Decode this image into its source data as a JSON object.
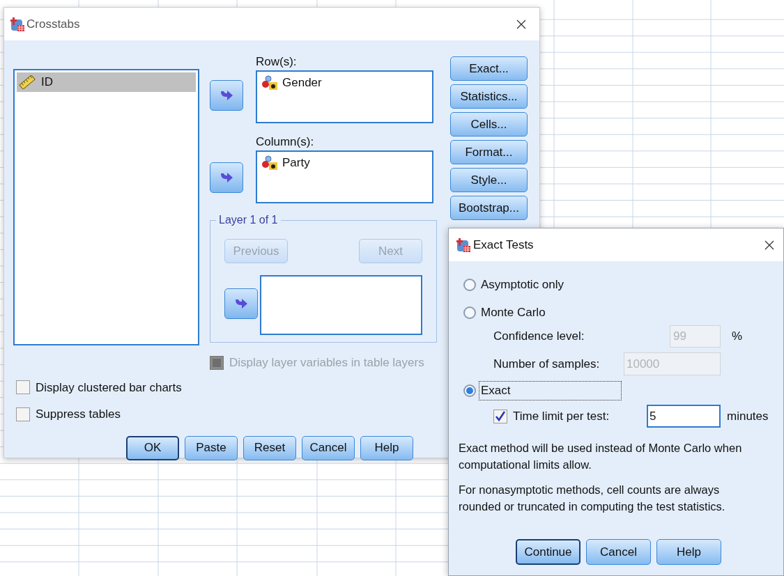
{
  "crosstabs": {
    "title": "Crosstabs",
    "variables": [
      {
        "label": "ID",
        "kind": "scale",
        "selected": true
      }
    ],
    "rows_label": "Row(s):",
    "rows_items": [
      {
        "label": "Gender",
        "kind": "nominal"
      }
    ],
    "columns_label": "Column(s):",
    "columns_items": [
      {
        "label": "Party",
        "kind": "nominal"
      }
    ],
    "side_buttons": [
      "Exact...",
      "Statistics...",
      "Cells...",
      "Format...",
      "Style...",
      "Bootstrap..."
    ],
    "layer": {
      "title": "Layer 1 of 1",
      "previous": {
        "label": "Previous",
        "disabled": true
      },
      "next": {
        "label": "Next",
        "disabled": true
      }
    },
    "layer_option": {
      "label": "Display layer variables in table layers",
      "checked": false,
      "disabled": true
    },
    "options": [
      {
        "label": "Display clustered bar charts",
        "checked": false
      },
      {
        "label": "Suppress tables",
        "checked": false
      }
    ],
    "buttons": [
      {
        "label": "OK",
        "default": true
      },
      {
        "label": "Paste",
        "default": false
      },
      {
        "label": "Reset",
        "default": false
      },
      {
        "label": "Cancel",
        "default": false
      },
      {
        "label": "Help",
        "default": false
      }
    ]
  },
  "exact_tests": {
    "title": "Exact Tests",
    "methods": [
      {
        "label": "Asymptotic only",
        "selected": false,
        "focused": false
      },
      {
        "label": "Monte Carlo",
        "selected": false,
        "focused": false
      },
      {
        "label": "Exact",
        "selected": true,
        "focused": true
      }
    ],
    "confidence": {
      "label": "Confidence level:",
      "value": "99",
      "unit": "%",
      "disabled": true
    },
    "samples": {
      "label": "Number of samples:",
      "value": "10000",
      "disabled": true
    },
    "time_limit": {
      "label": "Time limit per test:",
      "checked": true,
      "value": "5",
      "unit": "minutes"
    },
    "notes": [
      "Exact method will be used instead of Monte Carlo when computational limits allow.",
      "For nonasymptotic methods, cell counts are always rounded or truncated in computing the test statistics."
    ],
    "buttons": [
      {
        "label": "Continue",
        "default": true
      },
      {
        "label": "Cancel",
        "default": false
      },
      {
        "label": "Help",
        "default": false
      }
    ]
  }
}
